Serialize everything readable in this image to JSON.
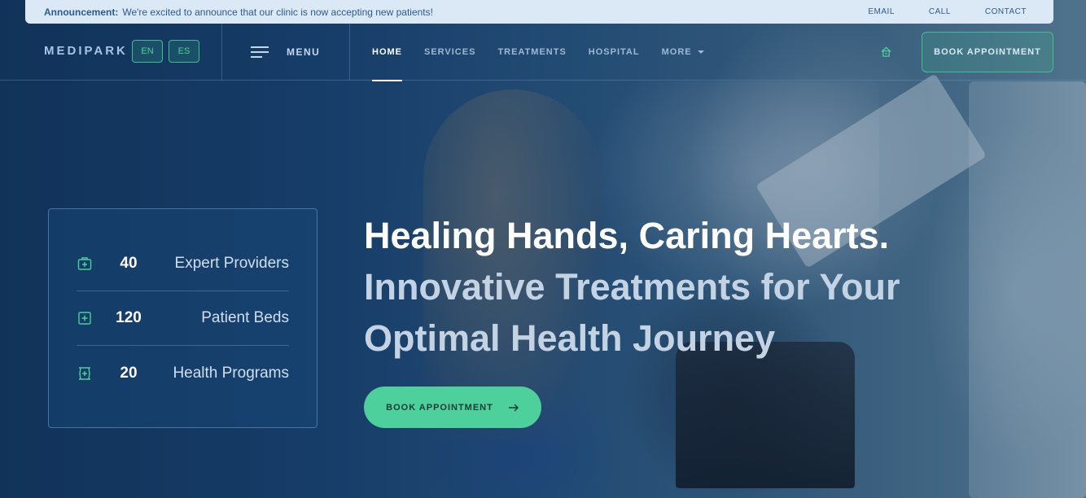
{
  "announcement": {
    "label": "Announcement:",
    "text": "We're excited to announce that our clinic is now accepting new patients!",
    "links": [
      "EMAIL",
      "CALL",
      "CONTACT"
    ]
  },
  "header": {
    "logo": "MEDIPARK",
    "languages": [
      "EN",
      "ES"
    ],
    "menu_label": "MENU",
    "nav": [
      {
        "label": "HOME",
        "active": true
      },
      {
        "label": "SERVICES",
        "active": false
      },
      {
        "label": "TREATMENTS",
        "active": false
      },
      {
        "label": "HOSPITAL",
        "active": false
      },
      {
        "label": "MORE",
        "active": false
      }
    ],
    "cta": "BOOK APPOINTMENT",
    "home_icon": "home-icon"
  },
  "stats": [
    {
      "icon": "medical-kit-icon",
      "value": "40",
      "label": "Expert Providers"
    },
    {
      "icon": "plus-square-icon",
      "value": "120",
      "label": "Patient Beds"
    },
    {
      "icon": "pharmacy-icon",
      "value": "20",
      "label": "Health Programs"
    }
  ],
  "hero": {
    "title": "Healing Hands, Caring Hearts.",
    "subtitle_line1": "Innovative Treatments for Your",
    "subtitle_line2": "Optimal Health Journey",
    "cta": "BOOK APPOINTMENT"
  },
  "colors": {
    "accent": "#4dd09b",
    "navy": "#12355a",
    "announce_bg": "#dbe8f5"
  }
}
